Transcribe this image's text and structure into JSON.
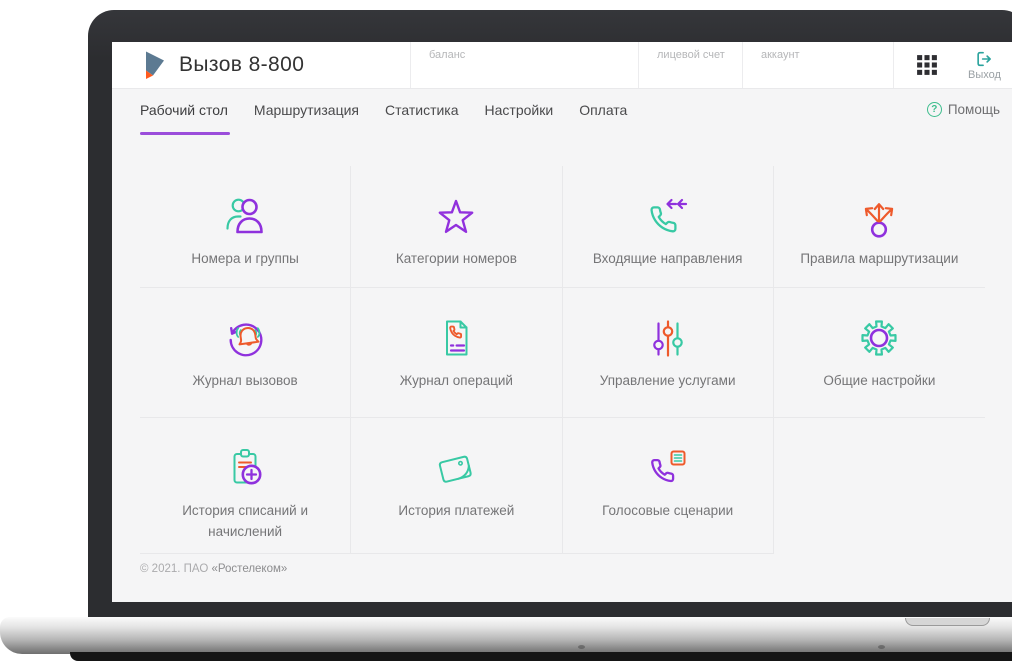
{
  "header": {
    "app_title": "Вызов 8-800",
    "fields": [
      {
        "label": "баланс"
      },
      {
        "label": "лицевой счет"
      },
      {
        "label": "аккаунт"
      }
    ],
    "logout_label": "Выход"
  },
  "nav": {
    "tabs": [
      {
        "label": "Рабочий стол",
        "active": true
      },
      {
        "label": "Маршрутизация",
        "active": false
      },
      {
        "label": "Статистика",
        "active": false
      },
      {
        "label": "Настройки",
        "active": false
      },
      {
        "label": "Оплата",
        "active": false
      }
    ],
    "help_label": "Помощь",
    "help_icon_char": "?"
  },
  "tiles": [
    {
      "label": "Номера и группы",
      "icon": "people-icon"
    },
    {
      "label": "Категории номеров",
      "icon": "star-icon"
    },
    {
      "label": "Входящие направления",
      "icon": "incoming-call-icon"
    },
    {
      "label": "Правила маршрутизации",
      "icon": "routing-rules-icon"
    },
    {
      "label": "Журнал вызовов",
      "icon": "call-journal-icon"
    },
    {
      "label": "Журнал операций",
      "icon": "operations-journal-icon"
    },
    {
      "label": "Управление услугами",
      "icon": "sliders-icon"
    },
    {
      "label": "Общие настройки",
      "icon": "gear-icon"
    },
    {
      "label": "История списаний и начислений",
      "icon": "clipboard-plus-icon"
    },
    {
      "label": "История платежей",
      "icon": "wallet-icon"
    },
    {
      "label": "Голосовые сценарии",
      "icon": "voice-script-icon"
    }
  ],
  "footer": {
    "copyright_prefix": "© 2021. ПАО ",
    "company": "«Ростелеком»"
  },
  "colors": {
    "accent_purple": "#8f31dd",
    "accent_teal": "#38c9a4",
    "accent_orange": "#ee5a2c",
    "tab_underline": "#9b4ddb",
    "help_green": "#3dbd8d",
    "logo_slate": "#5c7a92",
    "logo_orange": "#ff5a1e"
  }
}
